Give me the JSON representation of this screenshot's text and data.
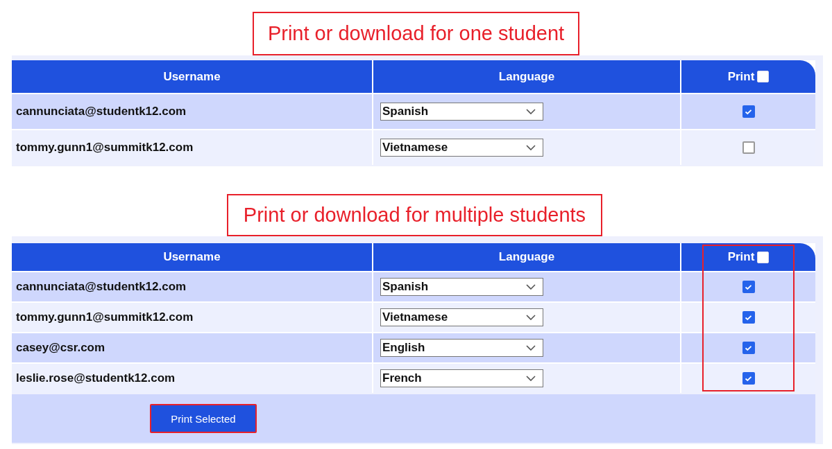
{
  "sections": [
    {
      "callout": "Print or download for one student",
      "columns": [
        "Username",
        "Language",
        "Print"
      ],
      "header_checkbox_checked": false,
      "highlight_print_column": false,
      "rows": [
        {
          "username": "cannunciata@studentk12.com",
          "language": "Spanish",
          "checked": true
        },
        {
          "username": "tommy.gunn1@summitk12.com",
          "language": "Vietnamese",
          "checked": false
        }
      ]
    },
    {
      "callout": "Print or download for multiple students",
      "columns": [
        "Username",
        "Language",
        "Print"
      ],
      "header_checkbox_checked": false,
      "highlight_print_column": true,
      "button": "Print Selected",
      "rows": [
        {
          "username": "cannunciata@studentk12.com",
          "language": "Spanish",
          "checked": true
        },
        {
          "username": "tommy.gunn1@summitk12.com",
          "language": "Vietnamese",
          "checked": true
        },
        {
          "username": "casey@csr.com",
          "language": "English",
          "checked": true
        },
        {
          "username": "leslie.rose@studentk12.com",
          "language": "French",
          "checked": true
        }
      ]
    }
  ]
}
